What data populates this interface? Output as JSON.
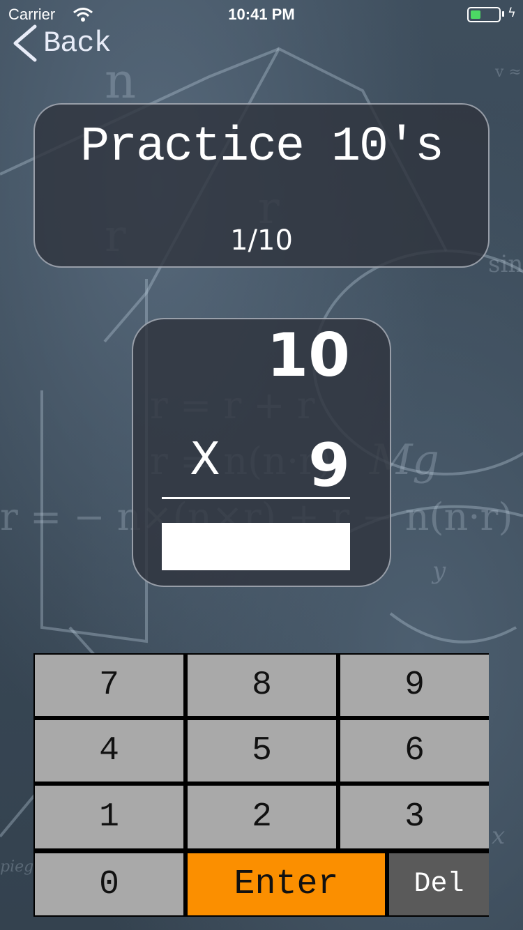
{
  "status_bar": {
    "carrier": "Carrier",
    "time": "10:41 PM",
    "battery_color": "#4cd964"
  },
  "nav": {
    "back_label": "Back"
  },
  "title_card": {
    "title": "Practice 10's",
    "progress": "1/10"
  },
  "problem": {
    "top_operand": "10",
    "operator": "X",
    "bottom_operand": "9",
    "answer_value": ""
  },
  "keypad": {
    "keys": {
      "k7": "7",
      "k8": "8",
      "k9": "9",
      "k4": "4",
      "k5": "5",
      "k6": "6",
      "k1": "1",
      "k2": "2",
      "k3": "3",
      "k0": "0",
      "enter": "Enter",
      "del": "Del"
    },
    "colors": {
      "digit": "#a9a9a9",
      "enter": "#fb8f00",
      "del": "#5a5a5a"
    }
  }
}
